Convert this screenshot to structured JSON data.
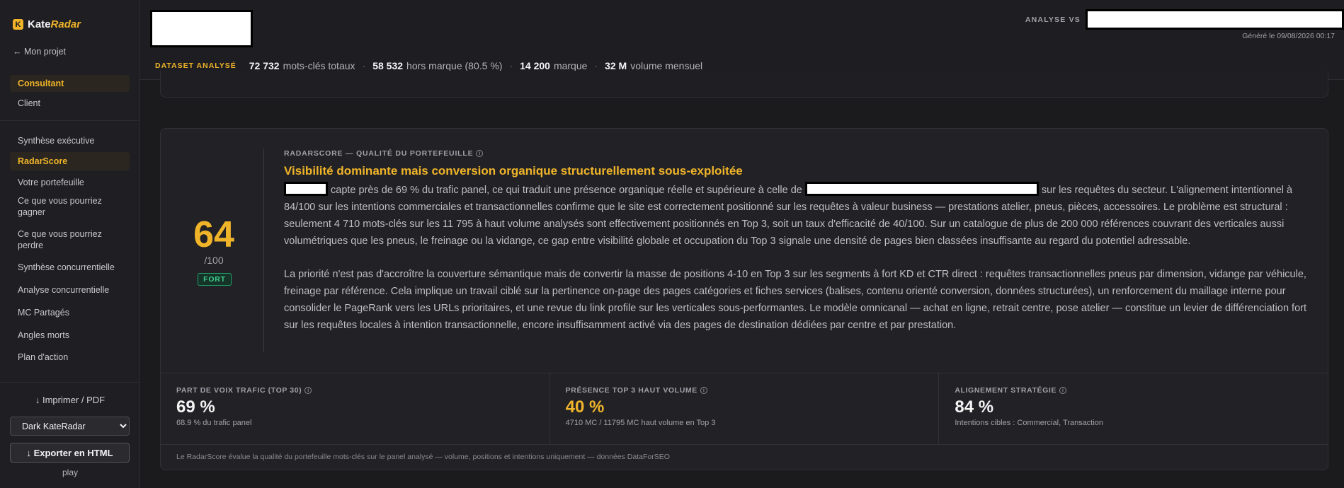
{
  "brand": {
    "name_part1": "Kate",
    "name_part2": "Radar",
    "logo_letter": "K"
  },
  "sidebar": {
    "back_label": "← Mon projet",
    "modes": [
      {
        "label": "Consultant",
        "active": true
      },
      {
        "label": "Client",
        "active": false
      }
    ],
    "sections": [
      {
        "label": "Synthèse exécutive",
        "active": false
      },
      {
        "label": "RadarScore",
        "active": true
      },
      {
        "label": "Votre portefeuille",
        "active": false
      },
      {
        "label": "Ce que vous pourriez gagner",
        "active": false
      },
      {
        "label": "Ce que vous pourriez perdre",
        "active": false
      },
      {
        "label": "Synthèse concurrentielle",
        "active": false
      },
      {
        "label": "Analyse concurrentielle",
        "active": false
      },
      {
        "label": "MC Partagés",
        "active": false
      },
      {
        "label": "Angles morts",
        "active": false
      },
      {
        "label": "Plan d'action",
        "active": false
      }
    ],
    "print_label": "↓ Imprimer / PDF",
    "theme_selected": "Dark KateRadar",
    "export_label": "↓ Exporter en HTML",
    "play_label": "play"
  },
  "header": {
    "analyse_label": "ANALYSE VS",
    "generated": "Généré le 09/08/2026 00:17",
    "dataset_label": "DATASET ANALYSÉ",
    "stats": [
      {
        "value": "72 732",
        "label": "mots-clés totaux"
      },
      {
        "value": "58 532",
        "label": "hors marque (80.5 %)"
      },
      {
        "value": "14 200",
        "label": "marque"
      },
      {
        "value": "32 M",
        "label": "volume mensuel"
      }
    ]
  },
  "card": {
    "score": "64",
    "score_max": "/100",
    "score_badge": "FORT",
    "kicker": "RADARSCORE — QUALITÉ DU PORTEFEUILLE",
    "headline": "Visibilité dominante mais conversion organique structurellement sous-exploitée",
    "p1_a": " capte près de 69 % du trafic panel, ce qui traduit une présence organique réelle et supérieure à celle de ",
    "p1_b": " sur les requêtes du secteur. L'alignement intentionnel à 84/100 sur les intentions commerciales et transactionnelles confirme que le site est correctement positionné sur les requêtes à valeur business — prestations atelier, pneus, pièces, accessoires. Le problème est structural : seulement 4 710 mots-clés sur les 11 795 à haut volume analysés sont effectivement positionnés en Top 3, soit un taux d'efficacité de 40/100. Sur un catalogue de plus de 200 000 références couvrant des verticales aussi volumétriques que les pneus, le freinage ou la vidange, ce gap entre visibilité globale et occupation du Top 3 signale une densité de pages bien classées insuffisante au regard du potentiel adressable.",
    "p2": "La priorité n'est pas d'accroître la couverture sémantique mais de convertir la masse de positions 4-10 en Top 3 sur les segments à fort KD et CTR direct : requêtes transactionnelles pneus par dimension, vidange par véhicule, freinage par référence. Cela implique un travail ciblé sur la pertinence on-page des pages catégories et fiches services (balises, contenu orienté conversion, données structurées), un renforcement du maillage interne pour consolider le PageRank vers les URLs prioritaires, et une revue du link profile sur les verticales sous-performantes. Le modèle omnicanal — achat en ligne, retrait centre, pose atelier — constitue un levier de différenciation fort sur les requêtes locales à intention transactionnelle, encore insuffisamment activé via des pages de destination dédiées par centre et par prestation.",
    "metrics": [
      {
        "label": "PART DE VOIX TRAFIC (TOP 30)",
        "value": "69 %",
        "sub": "68.9 % du trafic panel",
        "color": "#f4f4f5"
      },
      {
        "label": "PRÉSENCE TOP 3 HAUT VOLUME",
        "value": "40 %",
        "sub": "4710 MC / 11795 MC haut volume en Top 3",
        "color": "#f0b429"
      },
      {
        "label": "ALIGNEMENT STRATÉGIE",
        "value": "84 %",
        "sub": "Intentions cibles : Commercial, Transaction",
        "color": "#f4f4f5"
      }
    ],
    "footnote": "Le RadarScore évalue la qualité du portefeuille mots-clés sur le panel analysé — volume, positions et intentions uniquement — données DataForSEO"
  },
  "colors": {
    "accent": "#f0b429",
    "strong": "#3ecf8e",
    "bg": "#1b1b1e"
  }
}
